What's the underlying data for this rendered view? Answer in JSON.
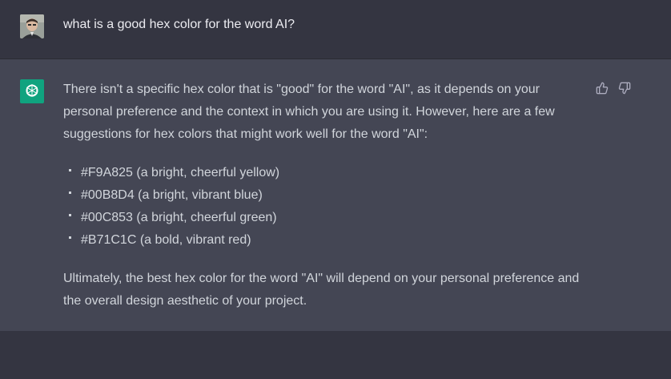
{
  "user": {
    "avatar_icon": "user-avatar-photo",
    "message": "what is a good hex color for the word AI?"
  },
  "assistant": {
    "avatar_icon": "openai-logo-icon",
    "avatar_color": "#10a37f",
    "intro": "There isn't a specific hex color that is \"good\" for the word \"AI\", as it depends on your personal preference and the context in which you are using it. However, here are a few suggestions for hex colors that might work well for the word \"AI\":",
    "suggestions": [
      "#F9A825 (a bright, cheerful yellow)",
      "#00B8D4 (a bright, vibrant blue)",
      "#00C853 (a bright, cheerful green)",
      "#B71C1C (a bold, vibrant red)"
    ],
    "conclusion": "Ultimately, the best hex color for the word \"AI\" will depend on your personal preference and the overall design aesthetic of your project.",
    "feedback": {
      "thumbs_up_icon": "thumbs-up-icon",
      "thumbs_down_icon": "thumbs-down-icon"
    }
  },
  "colors": {
    "user_bg": "#343541",
    "assistant_bg": "#444654",
    "text": "#d1d5db"
  }
}
